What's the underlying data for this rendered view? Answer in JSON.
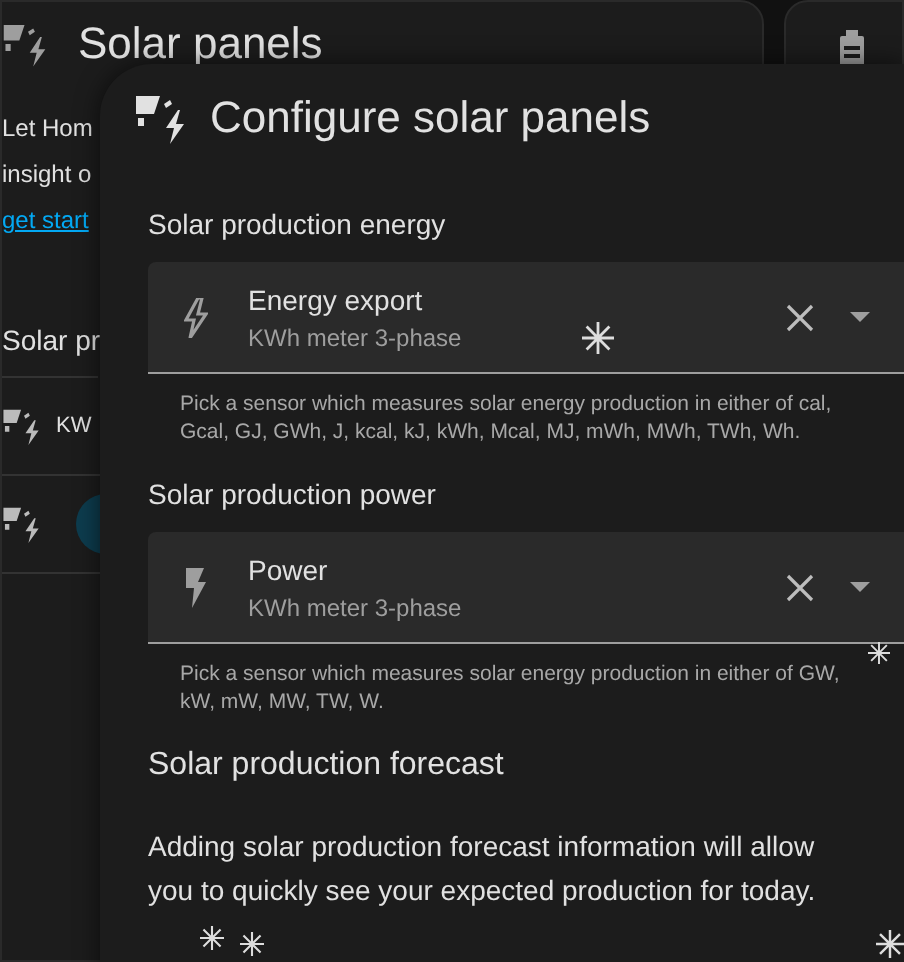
{
  "background_card": {
    "title": "Solar panels",
    "lines": [
      "Let Hom",
      "insight o"
    ],
    "link": "get start",
    "section": "Solar pr",
    "rows": [
      {
        "kind": "text",
        "label": "KW"
      },
      {
        "kind": "avatar"
      }
    ]
  },
  "dialog": {
    "title": "Configure solar panels",
    "sections": [
      {
        "kind": "entity",
        "heading": "Solar production energy",
        "field": {
          "kind": "energy",
          "value": "Energy export",
          "secondary": "KWh meter 3-phase"
        },
        "helper": "Pick a sensor which measures solar energy production in either of cal, Gcal, GJ, GWh, J, kcal, kJ, kWh, Mcal, MJ, mWh, MWh, TWh, Wh."
      },
      {
        "kind": "entity",
        "heading": "Solar production power",
        "field": {
          "kind": "power",
          "value": "Power",
          "secondary": "KWh meter 3-phase"
        },
        "helper": "Pick a sensor which measures solar energy production in either of GW, kW, mW, MW, TW, W."
      },
      {
        "kind": "text",
        "heading": "Solar production forecast",
        "text": "Adding solar production forecast information will allow you to quickly see your expected production for today."
      }
    ]
  }
}
